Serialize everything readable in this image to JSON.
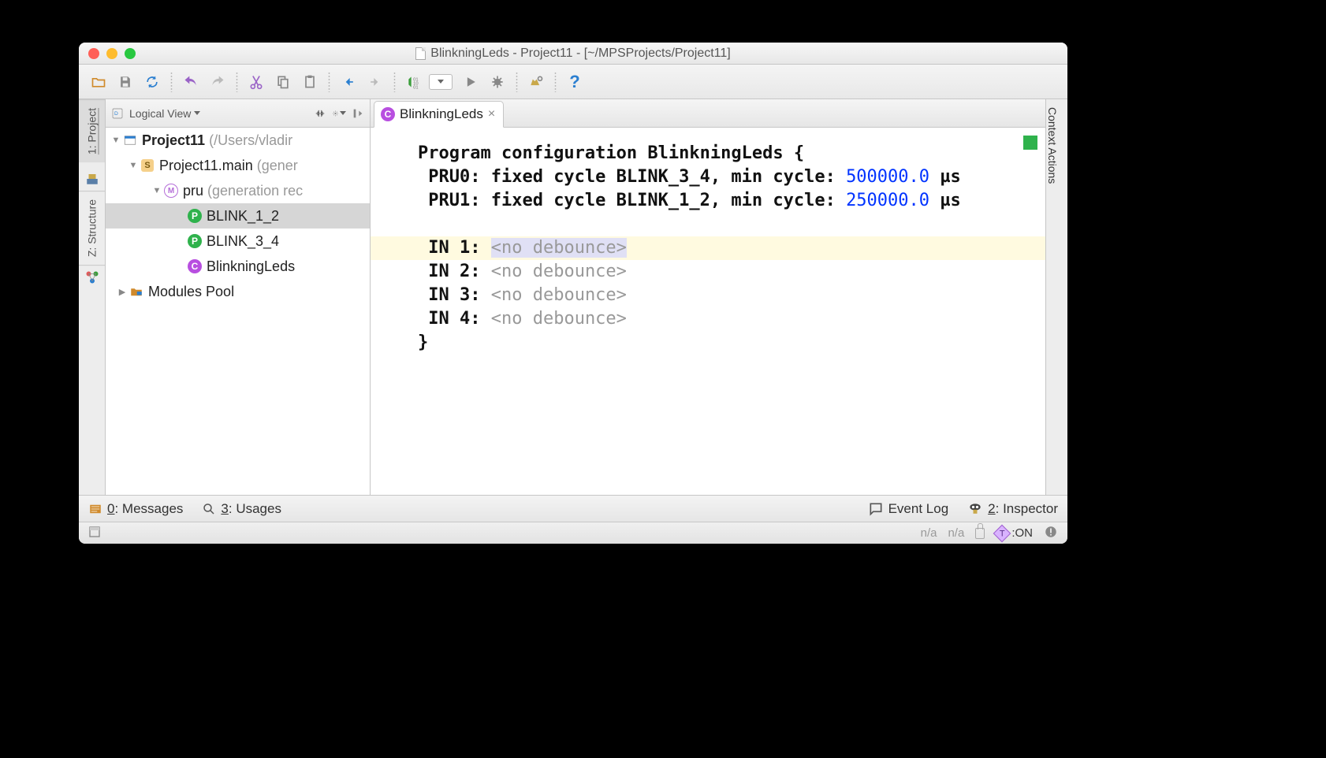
{
  "title": "BlinkningLeds - Project11 - [~/MPSProjects/Project11]",
  "leftrail": {
    "project": "1: Project",
    "structure": "Z: Structure"
  },
  "rightrail": {
    "context": "Context Actions"
  },
  "panel": {
    "view_label": "Logical View",
    "tree": {
      "root": {
        "name": "Project11",
        "path": "(/Users/vladir"
      },
      "main": {
        "name": "Project11.main",
        "note": "(gener"
      },
      "pru": {
        "name": "pru",
        "note": "(generation rec"
      },
      "blink12": "BLINK_1_2",
      "blink34": "BLINK_3_4",
      "blinkled": "BlinkningLeds",
      "modules_pool": "Modules Pool"
    }
  },
  "editor": {
    "tab": "BlinkningLeds",
    "header": "Program configuration BlinkningLeds {",
    "pru0_label": "PRU0: fixed cycle BLINK_3_4, min cycle: ",
    "pru0_val": "500000.0",
    "pru1_label": "PRU1: fixed cycle BLINK_1_2, min cycle: ",
    "pru1_val": "250000.0",
    "us": " µs",
    "in1_l": "IN 1: ",
    "in1_v": "<no debounce>",
    "in2_l": "IN 2: ",
    "in2_v": "<no debounce>",
    "in3_l": "IN 3: ",
    "in3_v": "<no debounce>",
    "in4_l": "IN 4: ",
    "in4_v": "<no debounce>",
    "close": "}"
  },
  "bottom": {
    "messages": "0: Messages",
    "usages": "3: Usages",
    "eventlog": "Event Log",
    "inspector": "2: Inspector"
  },
  "status": {
    "na1": "n/a",
    "na2": "n/a",
    "ton": ":ON"
  }
}
